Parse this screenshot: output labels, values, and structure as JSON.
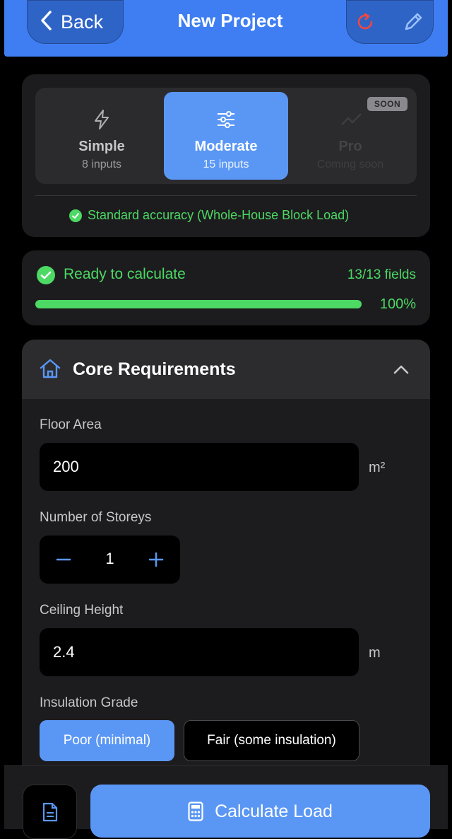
{
  "header": {
    "back_label": "Back",
    "title": "New Project",
    "actions": [
      "refresh-icon",
      "pencil-icon"
    ]
  },
  "modes": {
    "items": [
      {
        "name": "Simple",
        "sub": "8 inputs",
        "icon": "lightning-icon",
        "state": "available"
      },
      {
        "name": "Moderate",
        "sub": "15 inputs",
        "icon": "sliders-icon",
        "state": "selected"
      },
      {
        "name": "Pro",
        "sub": "Coming soon",
        "icon": "trend-icon",
        "state": "disabled",
        "badge": "SOON"
      }
    ],
    "accuracy": "Standard accuracy (Whole-House Block Load)"
  },
  "status": {
    "label": "Ready to calculate",
    "fields": "13/13 fields",
    "percent_label": "100%",
    "progress": 1.0
  },
  "section": {
    "title": "Core Requirements",
    "icon": "house-icon",
    "expanded": true
  },
  "fields": {
    "floor_area": {
      "label": "Floor Area",
      "value": "200",
      "unit": "m²"
    },
    "storeys": {
      "label": "Number of Storeys",
      "value": "1"
    },
    "ceiling_height": {
      "label": "Ceiling Height",
      "value": "2.4",
      "unit": "m"
    },
    "insulation": {
      "label": "Insulation Grade",
      "options": [
        "Poor (minimal)",
        "Fair (some insulation)"
      ],
      "selected": "Poor (minimal)"
    }
  },
  "footer": {
    "calculate_label": "Calculate Load"
  },
  "colors": {
    "accent": "#5a97f5",
    "header": "#3f7ef2",
    "success": "#4cd964",
    "refresh": "#ff453a"
  }
}
